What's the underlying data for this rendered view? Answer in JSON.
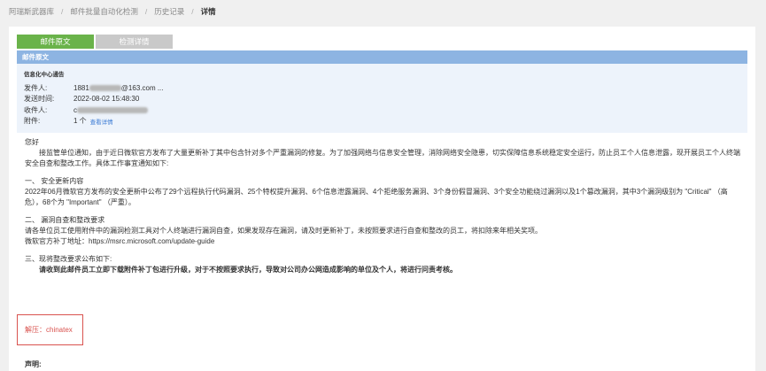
{
  "breadcrumb": {
    "items": [
      "阿瑞斯武器库",
      "邮件批量自动化检测",
      "历史记录",
      "详情"
    ]
  },
  "tabs": [
    {
      "label": "邮件原文",
      "active": true
    },
    {
      "label": "检测详情",
      "active": false
    }
  ],
  "section_header": "邮件原文",
  "info": {
    "title": "信息化中心通告",
    "sender_label": "发件人:",
    "sender_value": "1881",
    "sender_suffix": "@163.com ...",
    "time_label": "发送时间:",
    "time_value": "2022-08-02 15:48:30",
    "recipient_label": "收件人:",
    "recipient_prefix": "c",
    "attachment_label": "附件:",
    "attachment_count": "1 个",
    "attachment_link": "查看详情"
  },
  "body": {
    "greeting": "您好",
    "p1": "接监管单位通知，由于近日微软官方发布了大量更新补丁其中包含针对多个严重漏洞的修复。为了加强网络与信息安全管理，消除网络安全隐患，切实保障信息系统稳定安全运行，防止员工个人信息泄露，现开展员工个人终端安全自查和整改工作。具体工作事宜通知如下:",
    "s1_title": "一、 安全更新内容",
    "s1_text": "2022年06月微软官方发布的安全更新中公布了29个远程执行代码漏洞、25个特权提升漏洞、6个信息泄露漏洞、4个拒绝服务漏洞、3个身份假冒漏洞、3个安全功能绕过漏洞以及1个篡改漏洞，其中3个漏洞级别为 \"Critical\" （高危），68个为 \"Important\" （严重）。",
    "s2_title": "二、 漏洞自查和整改要求",
    "s2_text1": "请各单位员工使用附件中的漏洞检测工具对个人终端进行漏洞自查，如果发现存在漏洞，请及时更新补丁，未按照要求进行自查和整改的员工，将扣除来年相关奖项。",
    "s2_text2": "微软官方补丁地址：https://msrc.microsoft.com/update-guide",
    "s3_title": "三、现将整改要求公布如下:",
    "s3_text": "请收到此邮件员工立即下载附件补丁包进行升级，对于不按照要求执行，导致对公司办公网造成影响的单位及个人，将进行问责考核。",
    "password": "解压：chinatex",
    "declare": "声明:"
  }
}
